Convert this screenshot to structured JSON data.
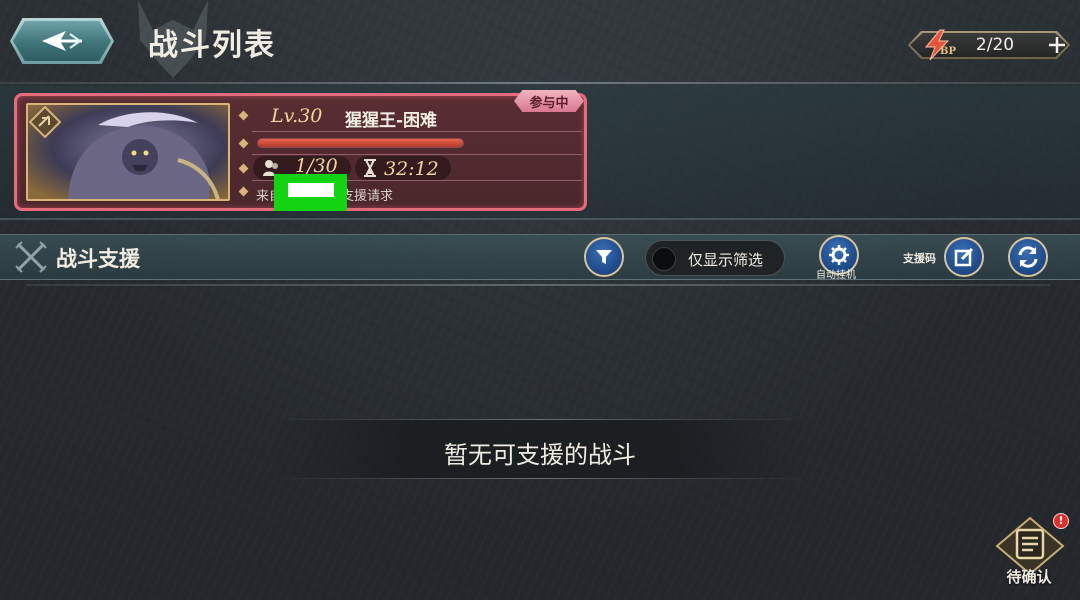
{
  "header": {
    "title": "战斗列表",
    "bp": {
      "label": "BP",
      "value": "2/20"
    }
  },
  "battle_card": {
    "status_tag": "参与中",
    "level": "Lv.30",
    "boss_name": "猩猩王-困难",
    "hp_fraction": 1.0,
    "player_count": "1/30",
    "timer": "32:12",
    "request_prefix": "来自",
    "request_suffix": "的支援请求"
  },
  "support": {
    "title": "战斗支援",
    "filter_toggle_label": "仅显示筛选",
    "auto_hangup_label": "自动挂机",
    "support_code_label": "支援码"
  },
  "empty_state": {
    "message": "暂无可支援的战斗"
  },
  "pending": {
    "label": "待确认",
    "badge": "!"
  },
  "colors": {
    "card_border": "#e86b7a",
    "accent_gold": "#f0d89a",
    "button_blue": "#1f4d8d",
    "hp_red": "#e8634d"
  }
}
